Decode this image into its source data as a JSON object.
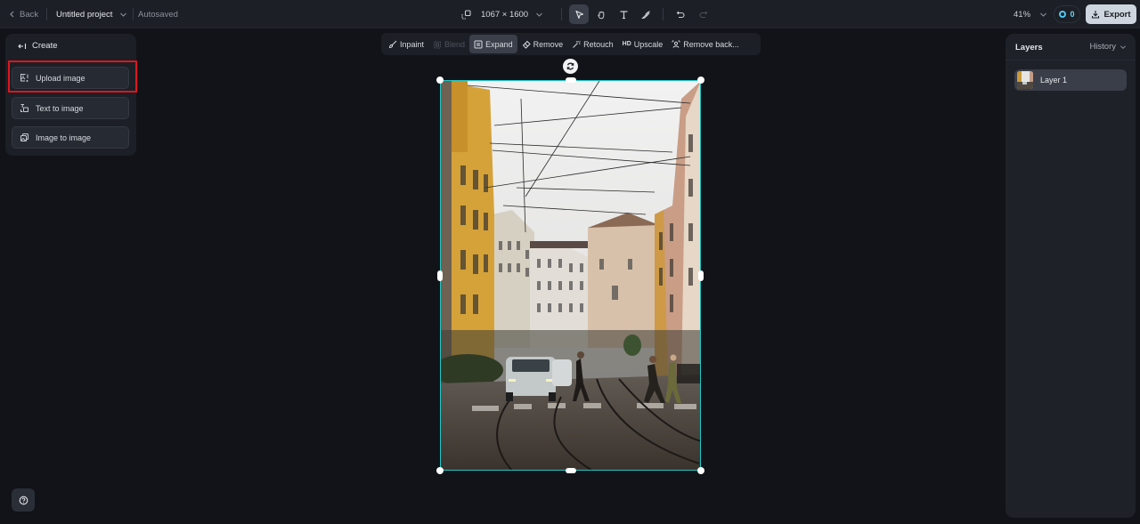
{
  "topbar": {
    "back_label": "Back",
    "project_name": "Untitled project",
    "save_status": "Autosaved",
    "canvas_size": "1067 × 1600",
    "tools": [
      {
        "name": "select",
        "icon": "pointer-icon",
        "active": true
      },
      {
        "name": "hand",
        "icon": "hand-icon",
        "active": false
      },
      {
        "name": "text",
        "icon": "text-icon",
        "active": false
      },
      {
        "name": "brush",
        "icon": "brush-icon",
        "active": false
      }
    ],
    "zoom_level": "41%",
    "credits": "0",
    "export_label": "Export"
  },
  "create_panel": {
    "title": "Create",
    "buttons": [
      {
        "label": "Upload image",
        "icon": "upload-image-icon",
        "highlighted": true
      },
      {
        "label": "Text to image",
        "icon": "text-to-image-icon"
      },
      {
        "label": "Image to image",
        "icon": "image-to-image-icon"
      }
    ]
  },
  "edit_tools": [
    {
      "label": "Inpaint",
      "icon": "inpaint-icon",
      "state": "normal"
    },
    {
      "label": "Blend",
      "icon": "blend-icon",
      "state": "disabled"
    },
    {
      "label": "Expand",
      "icon": "expand-icon",
      "state": "active"
    },
    {
      "label": "Remove",
      "icon": "eraser-icon",
      "state": "normal"
    },
    {
      "label": "Retouch",
      "icon": "magic-wand-icon",
      "state": "normal"
    },
    {
      "label": "Upscale",
      "icon_text": "HD",
      "state": "normal"
    },
    {
      "label": "Remove back...",
      "icon": "remove-background-icon",
      "state": "normal"
    }
  ],
  "canvas": {
    "image_description": "Milan street with tram tracks, yellow buildings, overhead wires, white car and pedestrians crossing",
    "selection_color": "#1fc7c7"
  },
  "layers_panel": {
    "title": "Layers",
    "history_label": "History",
    "layers": [
      {
        "name": "Layer 1"
      }
    ]
  },
  "colors": {
    "background": "#111318",
    "panel": "#1c1f26",
    "highlight": "#e0141e",
    "accent": "#1fc7c7",
    "credits": "#52c6ef",
    "export_bg": "#cdd6de"
  }
}
